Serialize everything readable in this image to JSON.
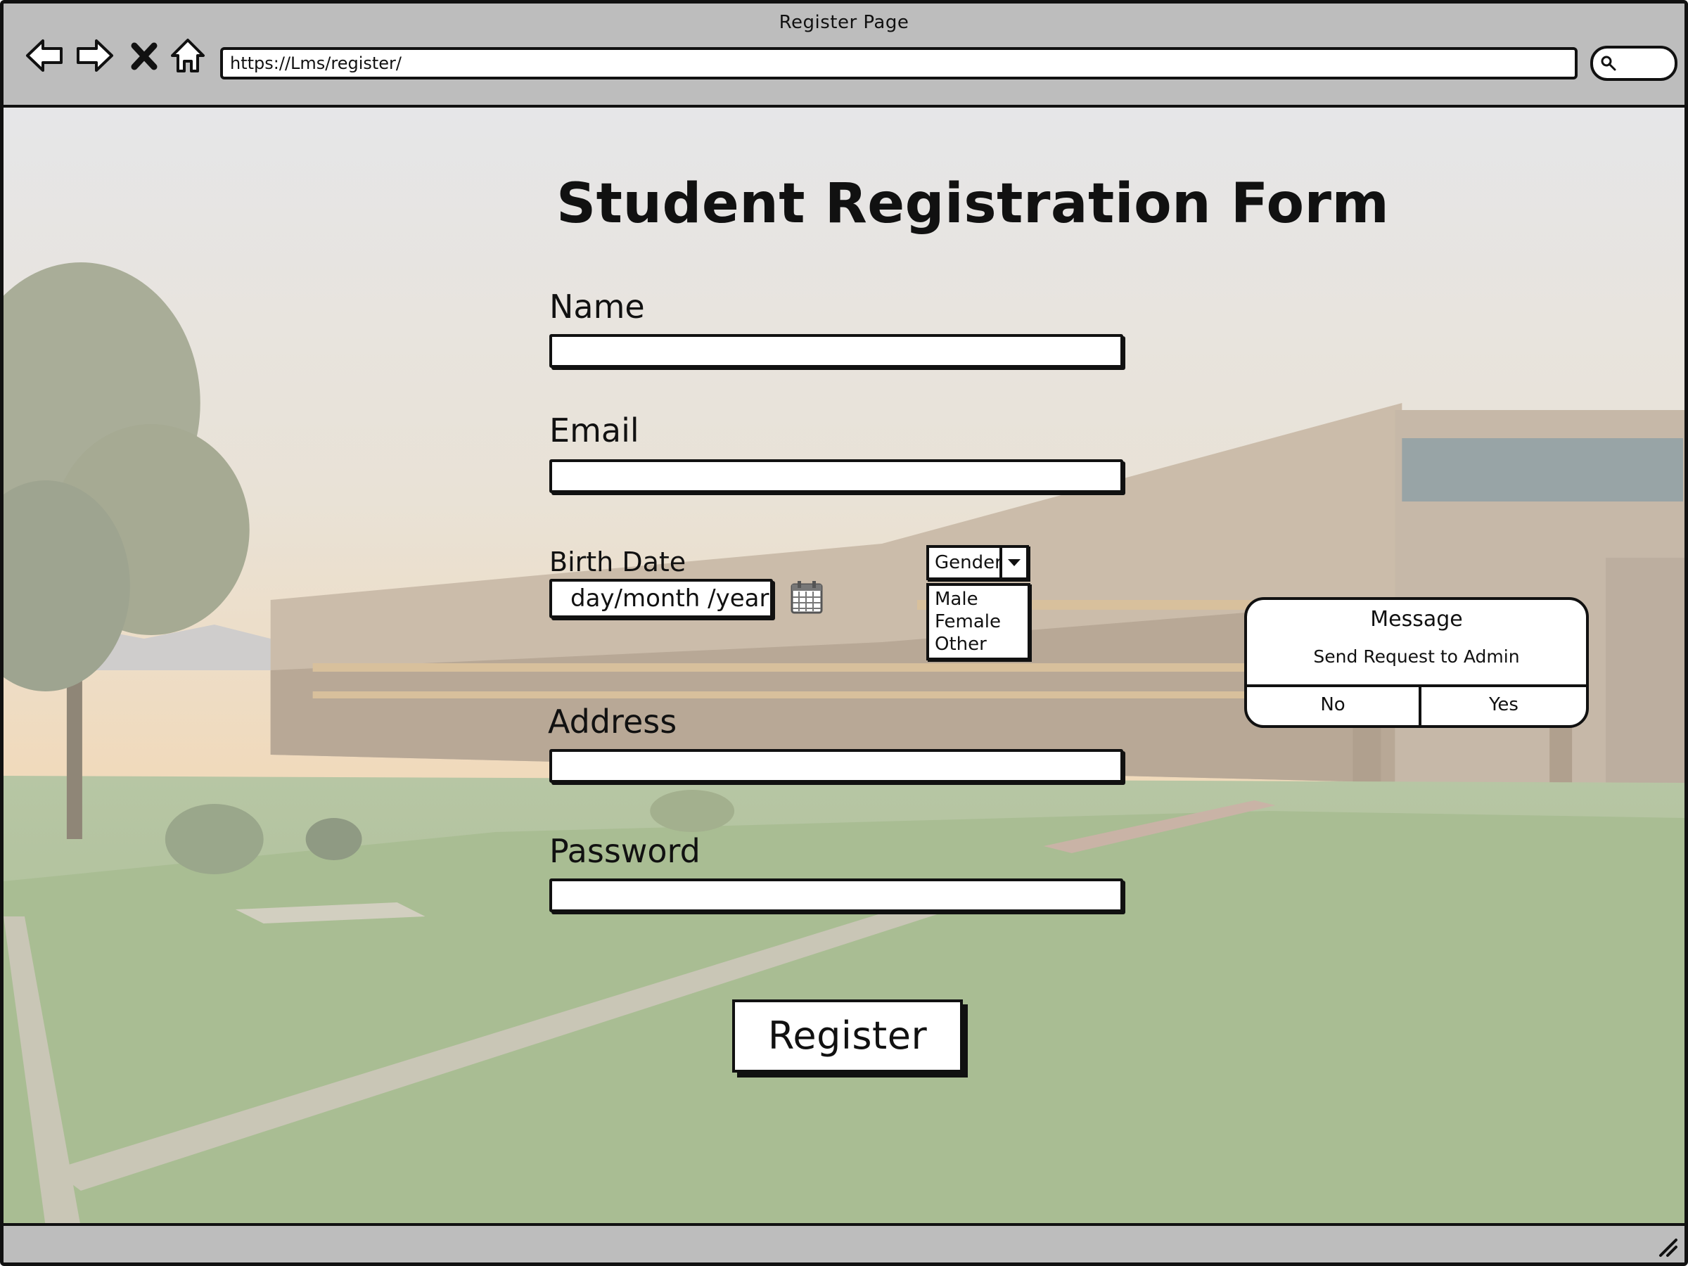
{
  "browser": {
    "page_title": "Register Page",
    "url": "https://Lms/register/",
    "nav_icons": [
      "back-arrow-icon",
      "forward-arrow-icon",
      "close-icon",
      "home-icon"
    ],
    "search_icon": "search-icon"
  },
  "form": {
    "title": "Student Registration Form",
    "name_label": "Name",
    "name_value": "",
    "email_label": "Email",
    "email_value": "",
    "birth_date_label": "Birth Date",
    "birth_date_placeholder": "day/month /year",
    "calendar_icon": "calendar-icon",
    "gender": {
      "selected": "Gender",
      "options": [
        "Male",
        "Female",
        "Other"
      ]
    },
    "address_label": "Address",
    "address_value": "",
    "password_label": "Password",
    "password_value": "",
    "register_label": "Register"
  },
  "dialog": {
    "title": "Message",
    "message": "Send Request to Admin",
    "no_label": "No",
    "yes_label": "Yes"
  },
  "colors": {
    "chrome": "#bdbdbd",
    "ink": "#111111",
    "field_bg": "#ffffff"
  }
}
